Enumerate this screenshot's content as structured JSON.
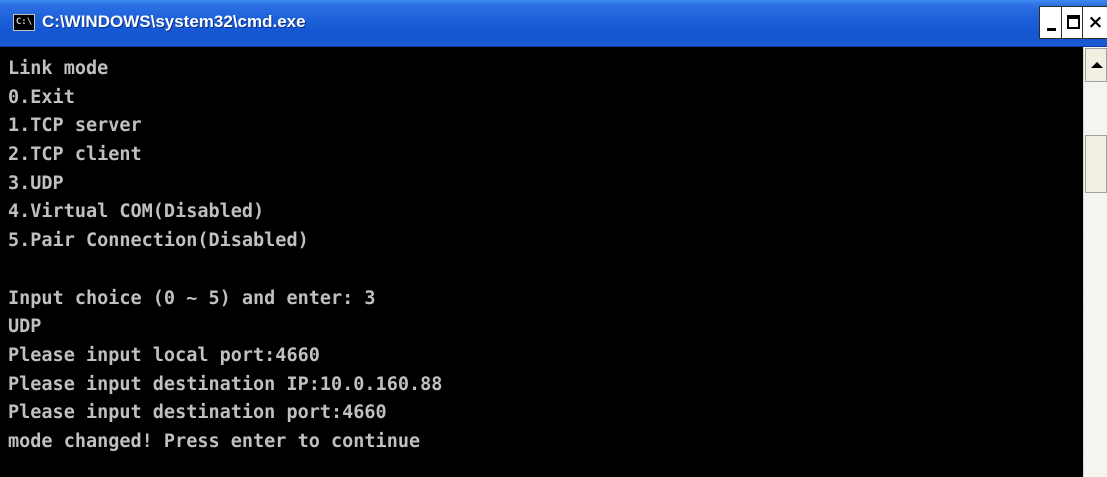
{
  "window": {
    "title": "C:\\WINDOWS\\system32\\cmd.exe",
    "icon_text": "C:\\",
    "controls": {
      "minimize": "minimize",
      "maximize": "maximize",
      "close": "×"
    }
  },
  "console": {
    "lines": [
      "Link mode",
      "0.Exit",
      "1.TCP server",
      "2.TCP client",
      "3.UDP",
      "4.Virtual COM(Disabled)",
      "5.Pair Connection(Disabled)",
      "",
      "Input choice (0 ~ 5) and enter: 3",
      "UDP",
      "Please input local port:4660",
      "Please input destination IP:10.0.160.88",
      "Please input destination port:4660",
      "mode changed! Press enter to continue"
    ]
  },
  "colors": {
    "titlebar": "#1b5fd8",
    "console_bg": "#000000",
    "console_text": "#c0c0c0"
  }
}
